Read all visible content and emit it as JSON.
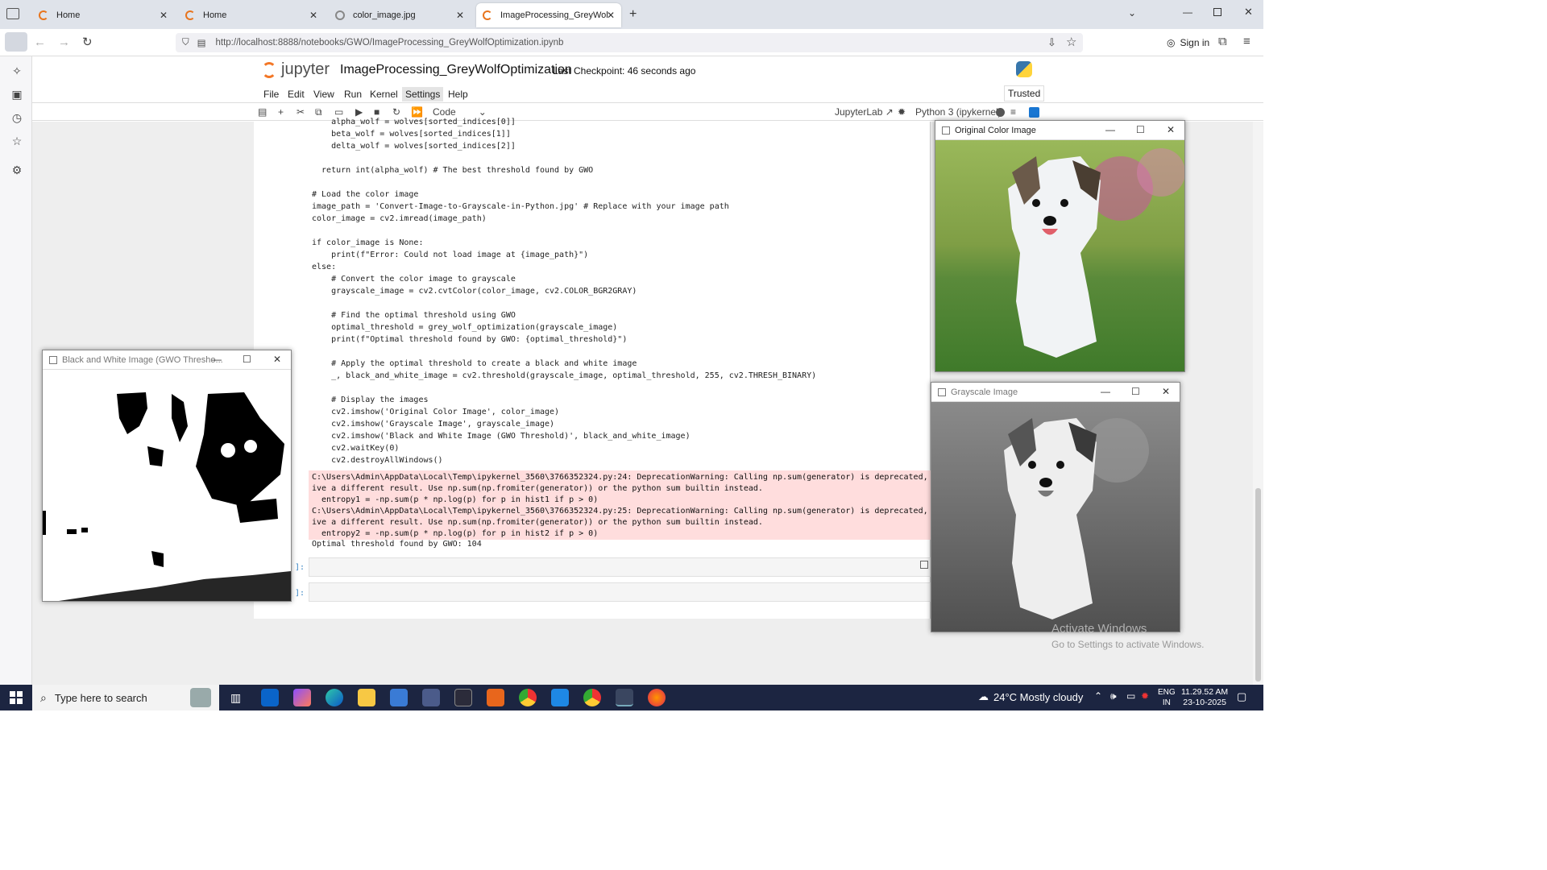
{
  "browser": {
    "tabs": [
      {
        "label": "Home"
      },
      {
        "label": "Home"
      },
      {
        "label": "color_image.jpg"
      },
      {
        "label": "ImageProcessing_GreyWolfOpti"
      }
    ],
    "url": "http://localhost:8888/notebooks/GWO/ImageProcessing_GreyWolfOptimization.ipynb",
    "sign_in": "Sign in"
  },
  "notebook": {
    "logo": "jupyter",
    "title": "ImageProcessing_GreyWolfOptimization",
    "checkpoint": "Last Checkpoint: 46 seconds ago",
    "trusted": "Trusted",
    "menu": [
      "File",
      "Edit",
      "View",
      "Run",
      "Kernel",
      "Settings",
      "Help"
    ],
    "cell_type": "Code",
    "jupyterlab": "JupyterLab",
    "kernel": "Python 3 (ipykernel)"
  },
  "code_lines": [
    "    alpha_wolf = wolves[sorted_indices[0]]",
    "    beta_wolf = wolves[sorted_indices[1]]",
    "    delta_wolf = wolves[sorted_indices[2]]",
    "",
    "  return int(alpha_wolf) # The best threshold found by GWO",
    "",
    "# Load the color image",
    "image_path = 'Convert-Image-to-Grayscale-in-Python.jpg' # Replace with your image path",
    "color_image = cv2.imread(image_path)",
    "",
    "if color_image is None:",
    "    print(f\"Error: Could not load image at {image_path}\")",
    "else:",
    "    # Convert the color image to grayscale",
    "    grayscale_image = cv2.cvtColor(color_image, cv2.COLOR_BGR2GRAY)",
    "",
    "    # Find the optimal threshold using GWO",
    "    optimal_threshold = grey_wolf_optimization(grayscale_image)",
    "    print(f\"Optimal threshold found by GWO: {optimal_threshold}\")",
    "",
    "    # Apply the optimal threshold to create a black and white image",
    "    _, black_and_white_image = cv2.threshold(grayscale_image, optimal_threshold, 255, cv2.THRESH_BINARY)",
    "",
    "    # Display the images",
    "    cv2.imshow('Original Color Image', color_image)",
    "    cv2.imshow('Grayscale Image', grayscale_image)",
    "    cv2.imshow('Black and White Image (GWO Threshold)', black_and_white_image)",
    "    cv2.waitKey(0)",
    "    cv2.destroyAllWindows()"
  ],
  "stderr": "C:\\Users\\Admin\\AppData\\Local\\Temp\\ipykernel_3560\\3766352324.py:24: DeprecationWarning: Calling np.sum(generator) is deprecated, and\nive a different result. Use np.sum(np.fromiter(generator)) or the python sum builtin instead.\n  entropy1 = -np.sum(p * np.log(p) for p in hist1 if p > 0)\nC:\\Users\\Admin\\AppData\\Local\\Temp\\ipykernel_3560\\3766352324.py:25: DeprecationWarning: Calling np.sum(generator) is deprecated, and\nive a different result. Use np.sum(np.fromiter(generator)) or the python sum builtin instead.\n  entropy2 = -np.sum(p * np.log(p) for p in hist2 if p > 0)",
  "stdout": "Optimal threshold found by GWO: 104",
  "prompts": [
    "]:",
    "]:"
  ],
  "windows": {
    "bw": "Black and White Image (GWO Thresho...",
    "color": "Original Color Image",
    "gray": "Grayscale Image"
  },
  "watermark": {
    "line1": "Activate Windows",
    "line2": "Go to Settings to activate Windows."
  },
  "taskbar": {
    "search": "Type here to search",
    "weather": "24°C  Mostly cloudy",
    "lang": "ENG",
    "region": "IN",
    "time": "11.29.52 AM",
    "date": "23-10-2025"
  }
}
